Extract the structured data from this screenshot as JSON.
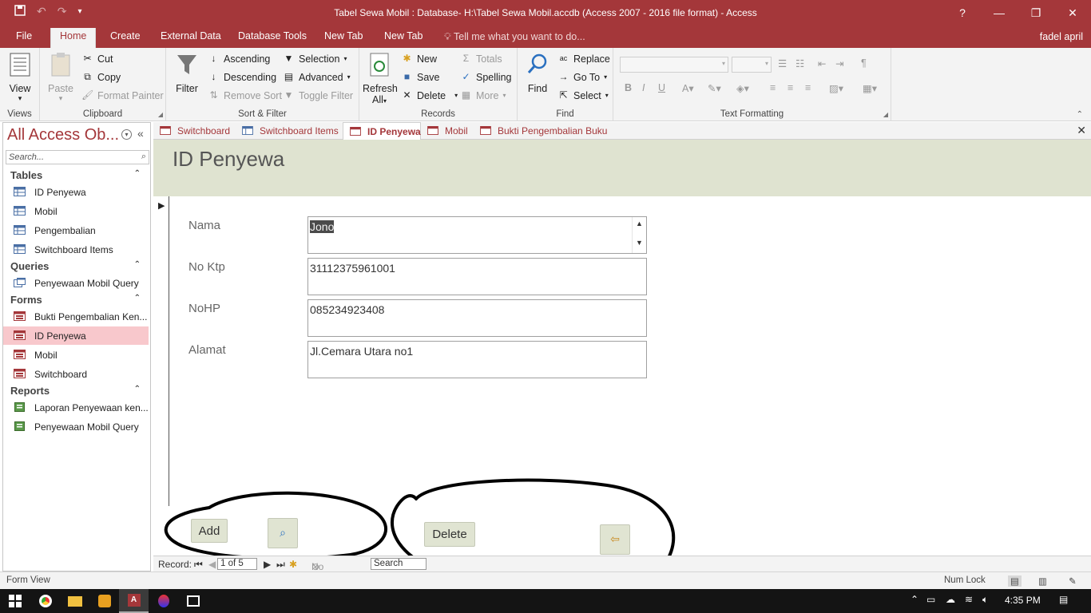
{
  "window": {
    "title": "Tabel Sewa Mobil : Database- H:\\Tabel Sewa Mobil.accdb (Access 2007 - 2016 file format) - Access",
    "help": "?",
    "minimize": "—",
    "restore": "❐",
    "close": "✕"
  },
  "menu": {
    "file": "File",
    "home": "Home",
    "create": "Create",
    "external_data": "External Data",
    "database_tools": "Database Tools",
    "new_tab_1": "New Tab",
    "new_tab_2": "New Tab",
    "tell_me": "Tell me what you want to do...",
    "user": "fadel april"
  },
  "ribbon": {
    "views": {
      "view": "View",
      "label": "Views"
    },
    "clipboard": {
      "paste": "Paste",
      "cut": "Cut",
      "copy": "Copy",
      "format_painter": "Format Painter",
      "label": "Clipboard"
    },
    "sort_filter": {
      "filter": "Filter",
      "ascending": "Ascending",
      "descending": "Descending",
      "remove_sort": "Remove Sort",
      "selection": "Selection",
      "advanced": "Advanced",
      "toggle_filter": "Toggle Filter",
      "label": "Sort & Filter"
    },
    "records": {
      "refresh": "Refresh",
      "refresh_all": "All",
      "new": "New",
      "save": "Save",
      "delete": "Delete",
      "totals": "Totals",
      "spelling": "Spelling",
      "more": "More",
      "label": "Records"
    },
    "find": {
      "find": "Find",
      "replace": "Replace",
      "go_to": "Go To",
      "select": "Select",
      "label": "Find"
    },
    "text_formatting": {
      "bold": "B",
      "italic": "I",
      "underline": "U",
      "label": "Text Formatting"
    }
  },
  "nav": {
    "title": "All Access Ob...",
    "search_placeholder": "Search...",
    "sections": [
      {
        "label": "Tables",
        "items": [
          "ID Penyewa",
          "Mobil",
          "Pengembalian",
          "Switchboard Items"
        ]
      },
      {
        "label": "Queries",
        "items": [
          "Penyewaan Mobil Query"
        ]
      },
      {
        "label": "Forms",
        "items": [
          "Bukti Pengembalian Ken...",
          "ID Penyewa",
          "Mobil",
          "Switchboard"
        ]
      },
      {
        "label": "Reports",
        "items": [
          "Laporan Penyewaan ken...",
          "Penyewaan Mobil Query"
        ]
      }
    ]
  },
  "doc_tabs": [
    "Switchboard",
    "Switchboard Items",
    "ID Penyewa",
    "Mobil",
    "Bukti Pengembalian Buku"
  ],
  "form": {
    "title": "ID Penyewa",
    "fields": [
      {
        "label": "Nama",
        "value": "Jono"
      },
      {
        "label": "No Ktp",
        "value": "31112375961001"
      },
      {
        "label": "NoHP",
        "value": "085234923408"
      },
      {
        "label": "Alamat",
        "value": "Jl.Cemara Utara no1"
      }
    ],
    "add_button": "Add",
    "delete_button": "Delete"
  },
  "record_nav": {
    "label": "Record:",
    "position": "1 of 5",
    "no_filter": "No Filter",
    "search": "Search"
  },
  "status": {
    "view": "Form View",
    "num_lock": "Num Lock"
  },
  "taskbar": {
    "time": "4:35 PM"
  },
  "colors": {
    "accent": "#a4373a",
    "form_header": "#dfe3d0",
    "nav_selected": "#f8c8cc"
  }
}
